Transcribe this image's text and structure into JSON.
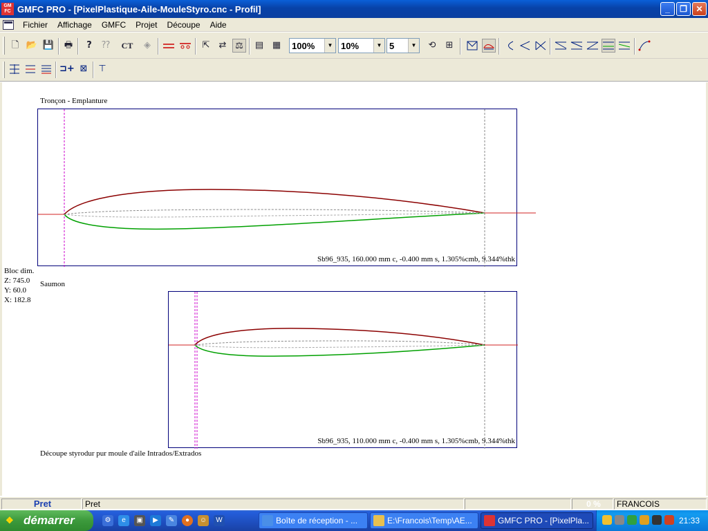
{
  "window": {
    "logo_text": "GM\nFC",
    "title": "GMFC PRO - [PixelPlastique-Aile-MouleStyro.cnc - Profil]",
    "minimize_glyph": "_",
    "maximize_glyph": "❐",
    "close_glyph": "✕"
  },
  "menu": {
    "items": [
      "Fichier",
      "Affichage",
      "GMFC",
      "Projet",
      "Découpe",
      "Aide"
    ],
    "mdi_minimize": "–",
    "mdi_restore": "❐",
    "mdi_close": "✕"
  },
  "toolbar": {
    "zoom_value": "100%",
    "step_value": "10%",
    "count_value": "5",
    "dropdown_glyph": "▼",
    "ct_label": "CT",
    "help_glyph": "?"
  },
  "drawing": {
    "bloc_dim": {
      "title": "Bloc dim.",
      "z": "Z: 745.0",
      "y": "Y: 60.0",
      "x": "X: 182.8"
    },
    "panels": [
      {
        "title": "Tronçon - Emplanture",
        "info": "Sb96_935, 160.000 mm c, -0.400 mm s, 1.305%cmb, 9.344%thk"
      },
      {
        "title": "Saumon",
        "info": "Sb96_935, 110.000 mm c, -0.400 mm s, 1.305%cmb, 9.344%thk"
      }
    ],
    "footer_note": "Découpe styrodur pur moule d'aile Intrados/Extrados",
    "colors": {
      "panel_border": "#00007a",
      "extrados": "#8b0000",
      "intrados": "#00a000",
      "chord_line": "#d02020",
      "marker_line": "#cc00cc",
      "camber_line": "#888888"
    }
  },
  "status": {
    "main": "Pret",
    "message": "Pret",
    "progress": "0 %",
    "user": "FRANCOIS"
  },
  "taskbar": {
    "start_label": "démarrer",
    "start_flag": "❖",
    "tasks": [
      {
        "label": "Boîte de réception - ..."
      },
      {
        "label": "E:\\Francois\\Temp\\AE..."
      },
      {
        "label": "GMFC PRO - [PixelPla..."
      }
    ],
    "clock": "21:33"
  }
}
